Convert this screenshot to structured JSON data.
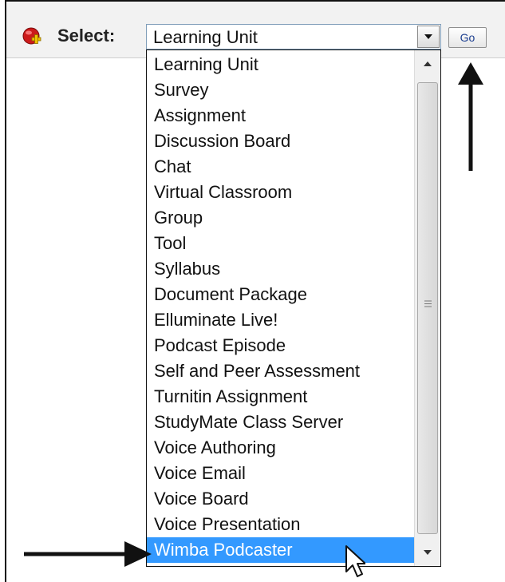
{
  "toolbar": {
    "select_label": "Select:",
    "add_icon": "red-plus-icon",
    "combo_value": "Learning Unit",
    "go_label": "Go"
  },
  "dropdown": {
    "selected_index": 19,
    "options": [
      "Learning Unit",
      "Survey",
      "Assignment",
      "Discussion Board",
      "Chat",
      "Virtual Classroom",
      "Group",
      "Tool",
      "Syllabus",
      "Document Package",
      "Elluminate Live!",
      "Podcast Episode",
      "Self and Peer Assessment",
      "Turnitin Assignment",
      "StudyMate Class Server",
      "Voice Authoring",
      "Voice Email",
      "Voice Board",
      "Voice Presentation",
      "Wimba Podcaster"
    ]
  },
  "colors": {
    "highlight": "#3399ff",
    "add_icon_red": "#cc1a1a",
    "add_icon_yellow": "#f2c200"
  }
}
